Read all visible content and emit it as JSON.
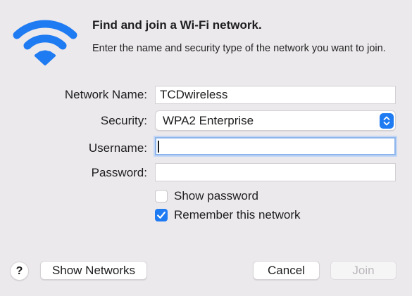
{
  "dialog": {
    "title": "Find and join a Wi-Fi network.",
    "description": "Enter the name and security type of the network you want to join."
  },
  "form": {
    "network_name": {
      "label": "Network Name:",
      "value": "TCDwireless"
    },
    "security": {
      "label": "Security:",
      "selected": "WPA2 Enterprise"
    },
    "username": {
      "label": "Username:",
      "value": ""
    },
    "password": {
      "label": "Password:",
      "value": ""
    },
    "show_password": {
      "label": "Show password",
      "checked": false
    },
    "remember_network": {
      "label": "Remember this network",
      "checked": true
    }
  },
  "buttons": {
    "help": "?",
    "show_networks": "Show Networks",
    "cancel": "Cancel",
    "join": "Join"
  },
  "colors": {
    "accent": "#1f7bf2",
    "background": "#ece9ec"
  },
  "icons": {
    "header": "wifi-icon",
    "security_select": "chevron-up-down-icon",
    "remember_checkbox": "checkmark-icon"
  }
}
